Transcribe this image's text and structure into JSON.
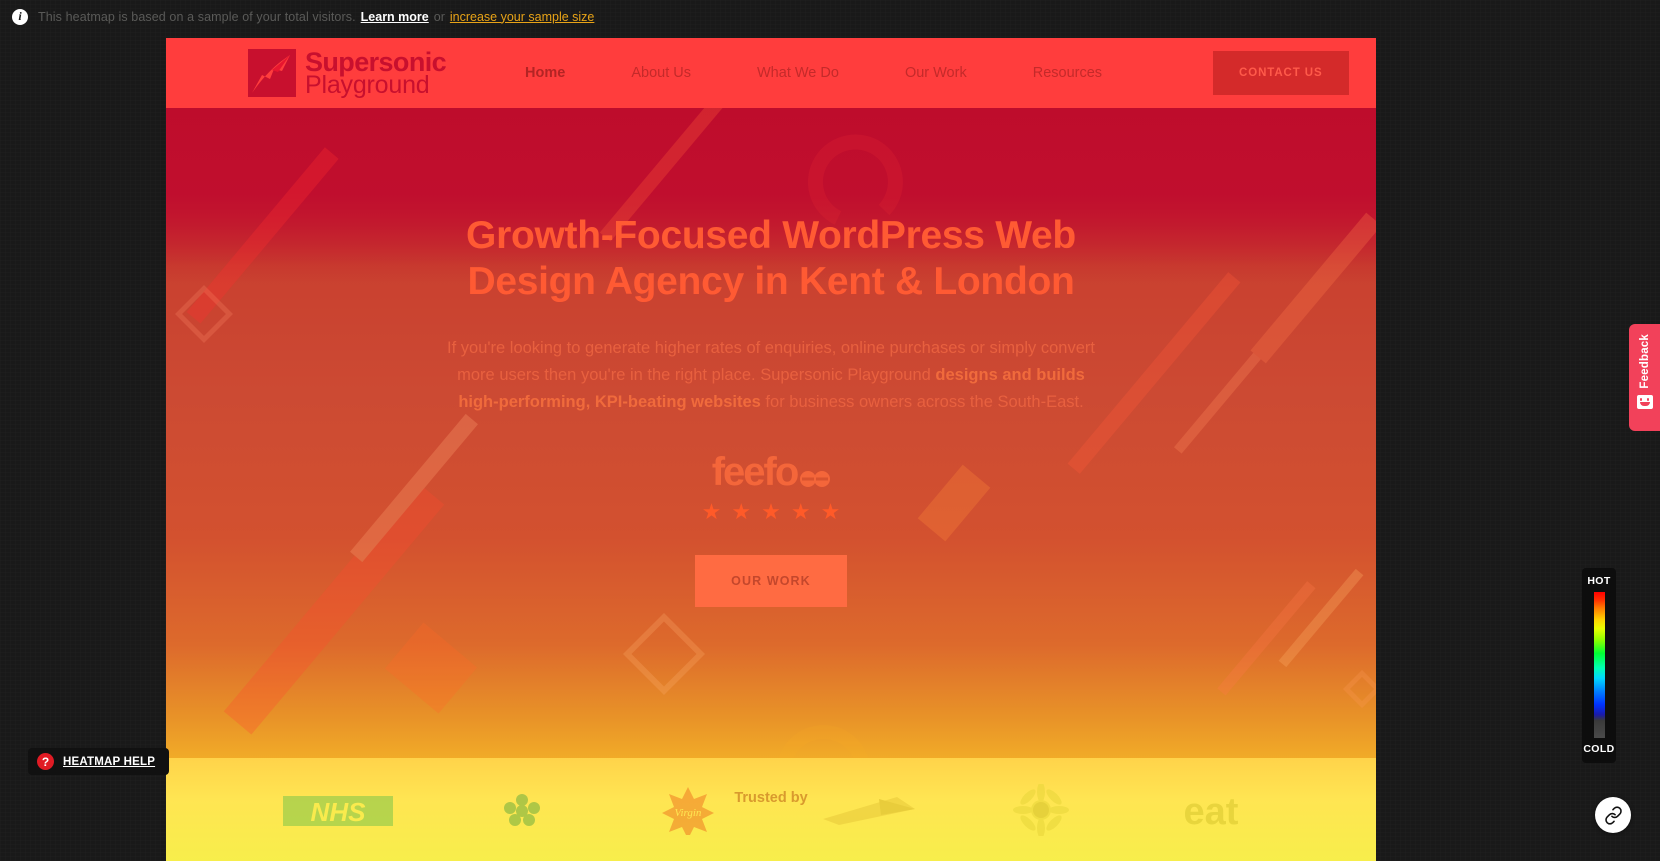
{
  "topbar": {
    "info_icon": "info-icon",
    "message": "This heatmap is based on a sample of your total visitors.",
    "learn_more": "Learn more",
    "or": "or",
    "increase_sample": "increase your sample size"
  },
  "site": {
    "logo": {
      "line1": "Supersonic",
      "line2": "Playground",
      "mark": "rocket-logo-icon"
    },
    "nav": [
      {
        "label": "Home",
        "active": true
      },
      {
        "label": "About Us",
        "active": false
      },
      {
        "label": "What We Do",
        "active": false
      },
      {
        "label": "Our Work",
        "active": false
      },
      {
        "label": "Resources",
        "active": false
      }
    ],
    "contact_button": "CONTACT US"
  },
  "hero": {
    "title": "Growth-Focused WordPress Web Design Agency in Kent & London",
    "subtitle_part1": "If you're looking to generate higher rates of enquiries, online purchases or simply convert more users then you're in the right place. Supersonic Playground ",
    "subtitle_bold": "designs and builds high-performing, KPI-beating websites",
    "subtitle_part2": " for business owners across the South-East.",
    "feefo_logo": "feefo",
    "star_count": 5,
    "star_glyph": "★",
    "cta_button": "OUR WORK",
    "trusted_by": "Trusted by"
  },
  "client_logos": [
    {
      "name": "NHS"
    },
    {
      "name": "Alzheimer's Society"
    },
    {
      "name": "Virgin"
    },
    {
      "name": "Sunseeker"
    },
    {
      "name": "Sunflower"
    },
    {
      "name": "eat"
    }
  ],
  "legend": {
    "hot_label": "HOT",
    "cold_label": "COLD",
    "gradient_stops": [
      "#ff0000",
      "#ffd400",
      "#00ff33",
      "#00d9ff",
      "#0033ff",
      "#4a4a4a"
    ]
  },
  "feedback": {
    "label": "Feedback",
    "icon": "smiley-face-icon",
    "color": "#f2415a"
  },
  "help": {
    "label": "HEATMAP HELP",
    "icon": "question-mark-icon",
    "icon_color": "#e01b24"
  },
  "share": {
    "icon": "link-icon"
  },
  "colors": {
    "brand_red": "#ff3d3d",
    "logo_red": "#c8102e",
    "accent_orange": "#ff5a33",
    "amber_link": "#e8a317",
    "chrome_dark": "#191919"
  }
}
